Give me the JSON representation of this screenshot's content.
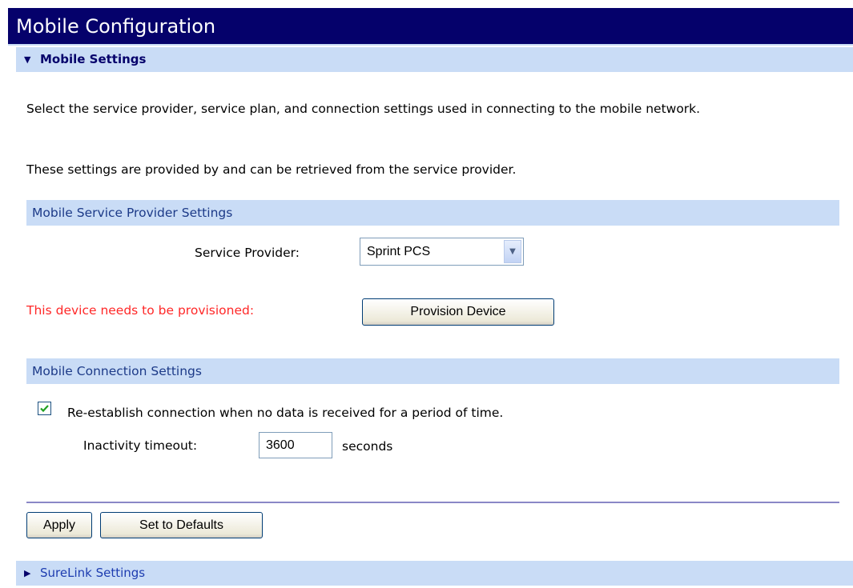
{
  "page": {
    "title": "Mobile Configuration"
  },
  "mobile_settings": {
    "header_label": "Mobile Settings",
    "intro": "Select the service provider, service plan, and connection settings used in connecting to the mobile network.",
    "note": "These settings are provided by and can be retrieved from the service provider."
  },
  "provider_section": {
    "title": "Mobile Service Provider Settings",
    "service_provider_label": "Service Provider:",
    "service_provider_value": "Sprint PCS",
    "provision_warning": "This device needs to be provisioned:",
    "provision_button": "Provision Device"
  },
  "connection_section": {
    "title": "Mobile Connection Settings",
    "reestablish_label": "Re-establish connection when no data is received for a period of time.",
    "reestablish_checked": true,
    "inactivity_label": "Inactivity timeout:",
    "inactivity_value": "3600",
    "inactivity_unit": "seconds"
  },
  "actions": {
    "apply": "Apply",
    "defaults": "Set to Defaults"
  },
  "surelink": {
    "header_label": "SureLink Settings"
  },
  "icons": {
    "expanded_arrow": "triangle-down-icon",
    "collapsed_arrow": "triangle-right-icon",
    "dropdown": "chevron-down-icon",
    "check": "check-icon"
  },
  "colors": {
    "title_bar": "#05016b",
    "section_bg": "#c9dcf6",
    "warning": "#ff2828",
    "link": "#1d3cb0"
  }
}
